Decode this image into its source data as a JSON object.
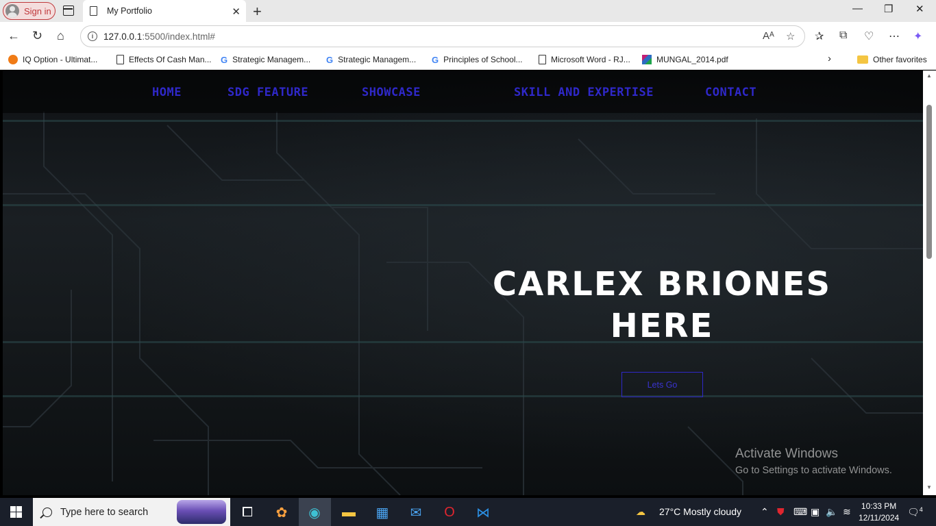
{
  "browser": {
    "signin_label": "Sign in",
    "tab_title": "My Portfolio",
    "url_host": "127.0.0.1",
    "url_rest": ":5500/index.html#",
    "bookmarks": [
      {
        "label": "IQ Option - Ultimat...",
        "icon": "iq-option-icon"
      },
      {
        "label": "Effects Of Cash Man...",
        "icon": "document-icon"
      },
      {
        "label": "Strategic Managem...",
        "icon": "google-icon"
      },
      {
        "label": "Strategic Managem...",
        "icon": "google-icon"
      },
      {
        "label": "Principles of School...",
        "icon": "google-icon"
      },
      {
        "label": "Microsoft Word - RJ...",
        "icon": "document-icon"
      },
      {
        "label": "MUNGAL_2014.pdf",
        "icon": "pdf-icon"
      }
    ],
    "other_favorites": "Other favorites"
  },
  "page": {
    "nav": [
      "HOME",
      "SDG FEATURE",
      "SHOWCASE",
      "SKILL AND EXPERTISE",
      "CONTACT"
    ],
    "hero_line1": "CARLEX BRIONES",
    "hero_line2": "HERE",
    "cta_label": "Lets Go",
    "accent_color": "#2f28c9"
  },
  "watermark": {
    "title": "Activate Windows",
    "subtitle": "Go to Settings to activate Windows."
  },
  "taskbar": {
    "search_placeholder": "Type here to search",
    "weather": "27°C  Mostly cloudy",
    "time": "10:33 PM",
    "date": "12/11/2024",
    "notification_count": "4"
  }
}
